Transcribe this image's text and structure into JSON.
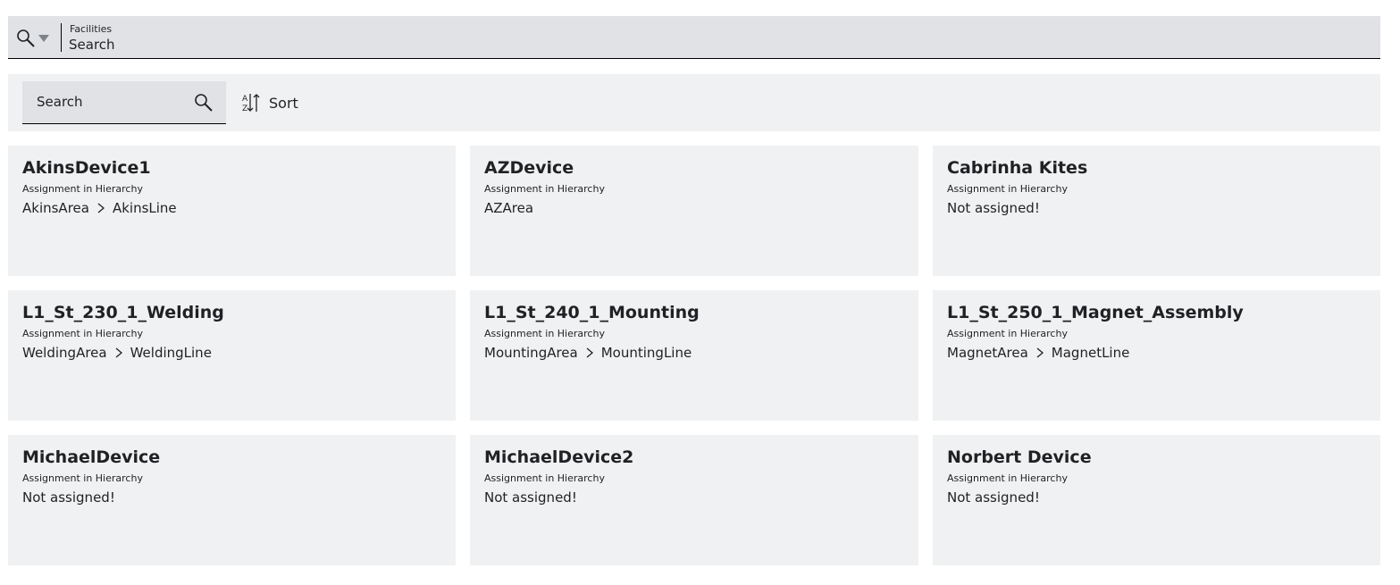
{
  "header": {
    "breadcrumb": "Facilities",
    "title": "Search",
    "search_icon": "magnifier-icon",
    "dropdown_icon": "caret-down-icon"
  },
  "toolbar": {
    "search_placeholder": "Search",
    "search_icon": "magnifier-icon",
    "sort_label": "Sort",
    "sort_icon": "sort-az-icon"
  },
  "assignment_label": "Assignment in Hierarchy",
  "devices": [
    {
      "name": "AkinsDevice1",
      "label": "Assignment in Hierarchy",
      "path": [
        "AkinsArea",
        "AkinsLine"
      ]
    },
    {
      "name": "AZDevice",
      "label": "Assignment in Hierarchy",
      "path": [
        "AZArea"
      ]
    },
    {
      "name": "Cabrinha Kites",
      "label": "Assignment in Hierarchy",
      "path": [
        "Not assigned!"
      ]
    },
    {
      "name": "L1_St_230_1_Welding",
      "label": "Assignment in Hierarchy",
      "path": [
        "WeldingArea",
        "WeldingLine"
      ]
    },
    {
      "name": "L1_St_240_1_Mounting",
      "label": "Assignment in Hierarchy",
      "path": [
        "MountingArea",
        "MountingLine"
      ]
    },
    {
      "name": "L1_St_250_1_Magnet_Assembly",
      "label": "Assignment in Hierarchy",
      "path": [
        "MagnetArea",
        "MagnetLine"
      ]
    },
    {
      "name": "MichaelDevice",
      "label": "Assignment in Hierarchy",
      "path": [
        "Not assigned!"
      ]
    },
    {
      "name": "MichaelDevice2",
      "label": "Assignment in Hierarchy",
      "path": [
        "Not assigned!"
      ]
    },
    {
      "name": "Norbert Device",
      "label": "Assignment in Hierarchy",
      "path": [
        "Not assigned!"
      ]
    }
  ]
}
